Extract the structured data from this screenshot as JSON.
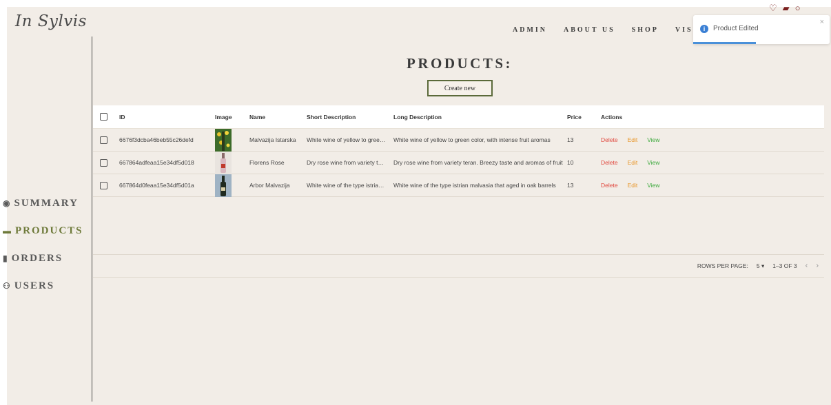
{
  "brand": {
    "logo": "In Sylvis"
  },
  "nav": {
    "items": [
      "ADMIN",
      "ABOUT US",
      "SHOP",
      "VISI"
    ]
  },
  "sidebar": {
    "items": [
      {
        "label": "SUMMARY",
        "icon": "tachometer-icon",
        "active": false
      },
      {
        "label": "PRODUCTS",
        "icon": "box-icon",
        "active": true
      },
      {
        "label": "ORDERS",
        "icon": "clipboard-icon",
        "active": false
      },
      {
        "label": "USERS",
        "icon": "users-icon",
        "active": false
      }
    ]
  },
  "main": {
    "title": "PRODUCTS:",
    "create_label": "Create new"
  },
  "table": {
    "headers": [
      "ID",
      "Image",
      "Name",
      "Short Description",
      "Long Description",
      "Price",
      "Actions"
    ],
    "rows": [
      {
        "id": "6676f3dcba46beb55c26defd",
        "name": "Malvazija Istarska",
        "short": "White wine of yellow to green color",
        "long": "White wine of yellow to green color, with intense fruit aromas",
        "price": "13",
        "image": "yellow-flowers-bottle"
      },
      {
        "id": "667864adfeaa15e34df5d018",
        "name": "Florens Rose",
        "short": "Dry rose wine from variety teran",
        "long": "Dry rose wine from variety teran. Breezy taste and aromas of fruit",
        "price": "10",
        "image": "rose-bottle"
      },
      {
        "id": "667864d0feaa15e34df5d01a",
        "name": "Arbor Malvazija",
        "short": "White wine of the type istrian malvasia",
        "long": "White wine of the type istrian malvasia that aged in oak barrels",
        "price": "13",
        "image": "dark-bottle"
      }
    ],
    "actions": {
      "delete": "Delete",
      "edit": "Edit",
      "view": "View"
    }
  },
  "pager": {
    "rows_label": "ROWS PER PAGE:",
    "rows_value": "5",
    "range": "1–3 OF 3"
  },
  "toast": {
    "message": "Product Edited",
    "progress": 0.46
  },
  "colors": {
    "background": "#f2ede7",
    "accent": "#6e7a3a",
    "delete": "#e0463c",
    "edit": "#e8962a",
    "view": "#3aa83a",
    "info": "#3a7fd4"
  }
}
